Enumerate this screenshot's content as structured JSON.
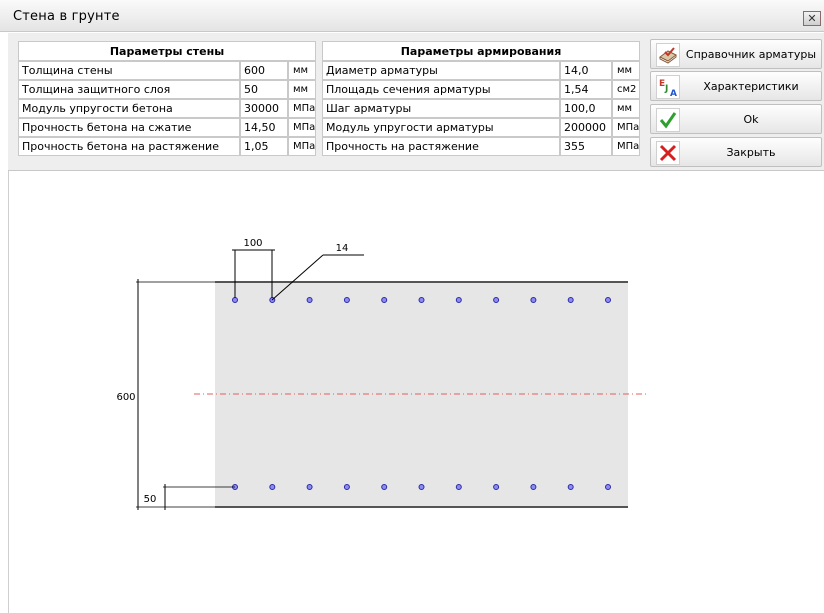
{
  "window": {
    "title": "Стена в грунте",
    "close_glyph": "✕"
  },
  "wall_params": {
    "header": "Параметры стены",
    "rows": [
      {
        "label": "Толщина стены",
        "value": "600",
        "unit": "мм"
      },
      {
        "label": "Толщина защитного слоя",
        "value": "50",
        "unit": "мм"
      },
      {
        "label": "Модуль упругости бетона",
        "value": "30000",
        "unit": "МПа"
      },
      {
        "label": "Прочность бетона на сжатие",
        "value": "14,50",
        "unit": "МПа"
      },
      {
        "label": "Прочность бетона на растяжение",
        "value": "1,05",
        "unit": "МПа"
      }
    ]
  },
  "rebar_params": {
    "header": "Параметры армирования",
    "rows": [
      {
        "label": "Диаметр арматуры",
        "value": "14,0",
        "unit": "мм"
      },
      {
        "label": "Площадь сечения арматуры",
        "value": "1,54",
        "unit": "см2"
      },
      {
        "label": "Шаг арматуры",
        "value": "100,0",
        "unit": "мм"
      },
      {
        "label": "Модуль упругости арматуры",
        "value": "200000",
        "unit": "МПа"
      },
      {
        "label": "Прочность на растяжение",
        "value": "355",
        "unit": "МПа"
      }
    ]
  },
  "buttons": {
    "handbook": {
      "label": "Справочник арматуры",
      "icon": "book-check-icon"
    },
    "characteristics": {
      "label": "Характеристики",
      "icon": "eja-icon"
    },
    "ok": {
      "label": "Ok",
      "icon": "green-check-icon"
    },
    "close": {
      "label": "Закрыть",
      "icon": "red-x-icon"
    }
  },
  "drawing": {
    "step_label": "100",
    "diameter_label": "14",
    "thickness_label": "600",
    "cover_label": "50",
    "rebar_count_per_row": 11,
    "colors": {
      "concrete": "#e6e6e6",
      "edge": "#555555",
      "rebar": "#2a2aa8",
      "axis": "#e06060"
    }
  }
}
